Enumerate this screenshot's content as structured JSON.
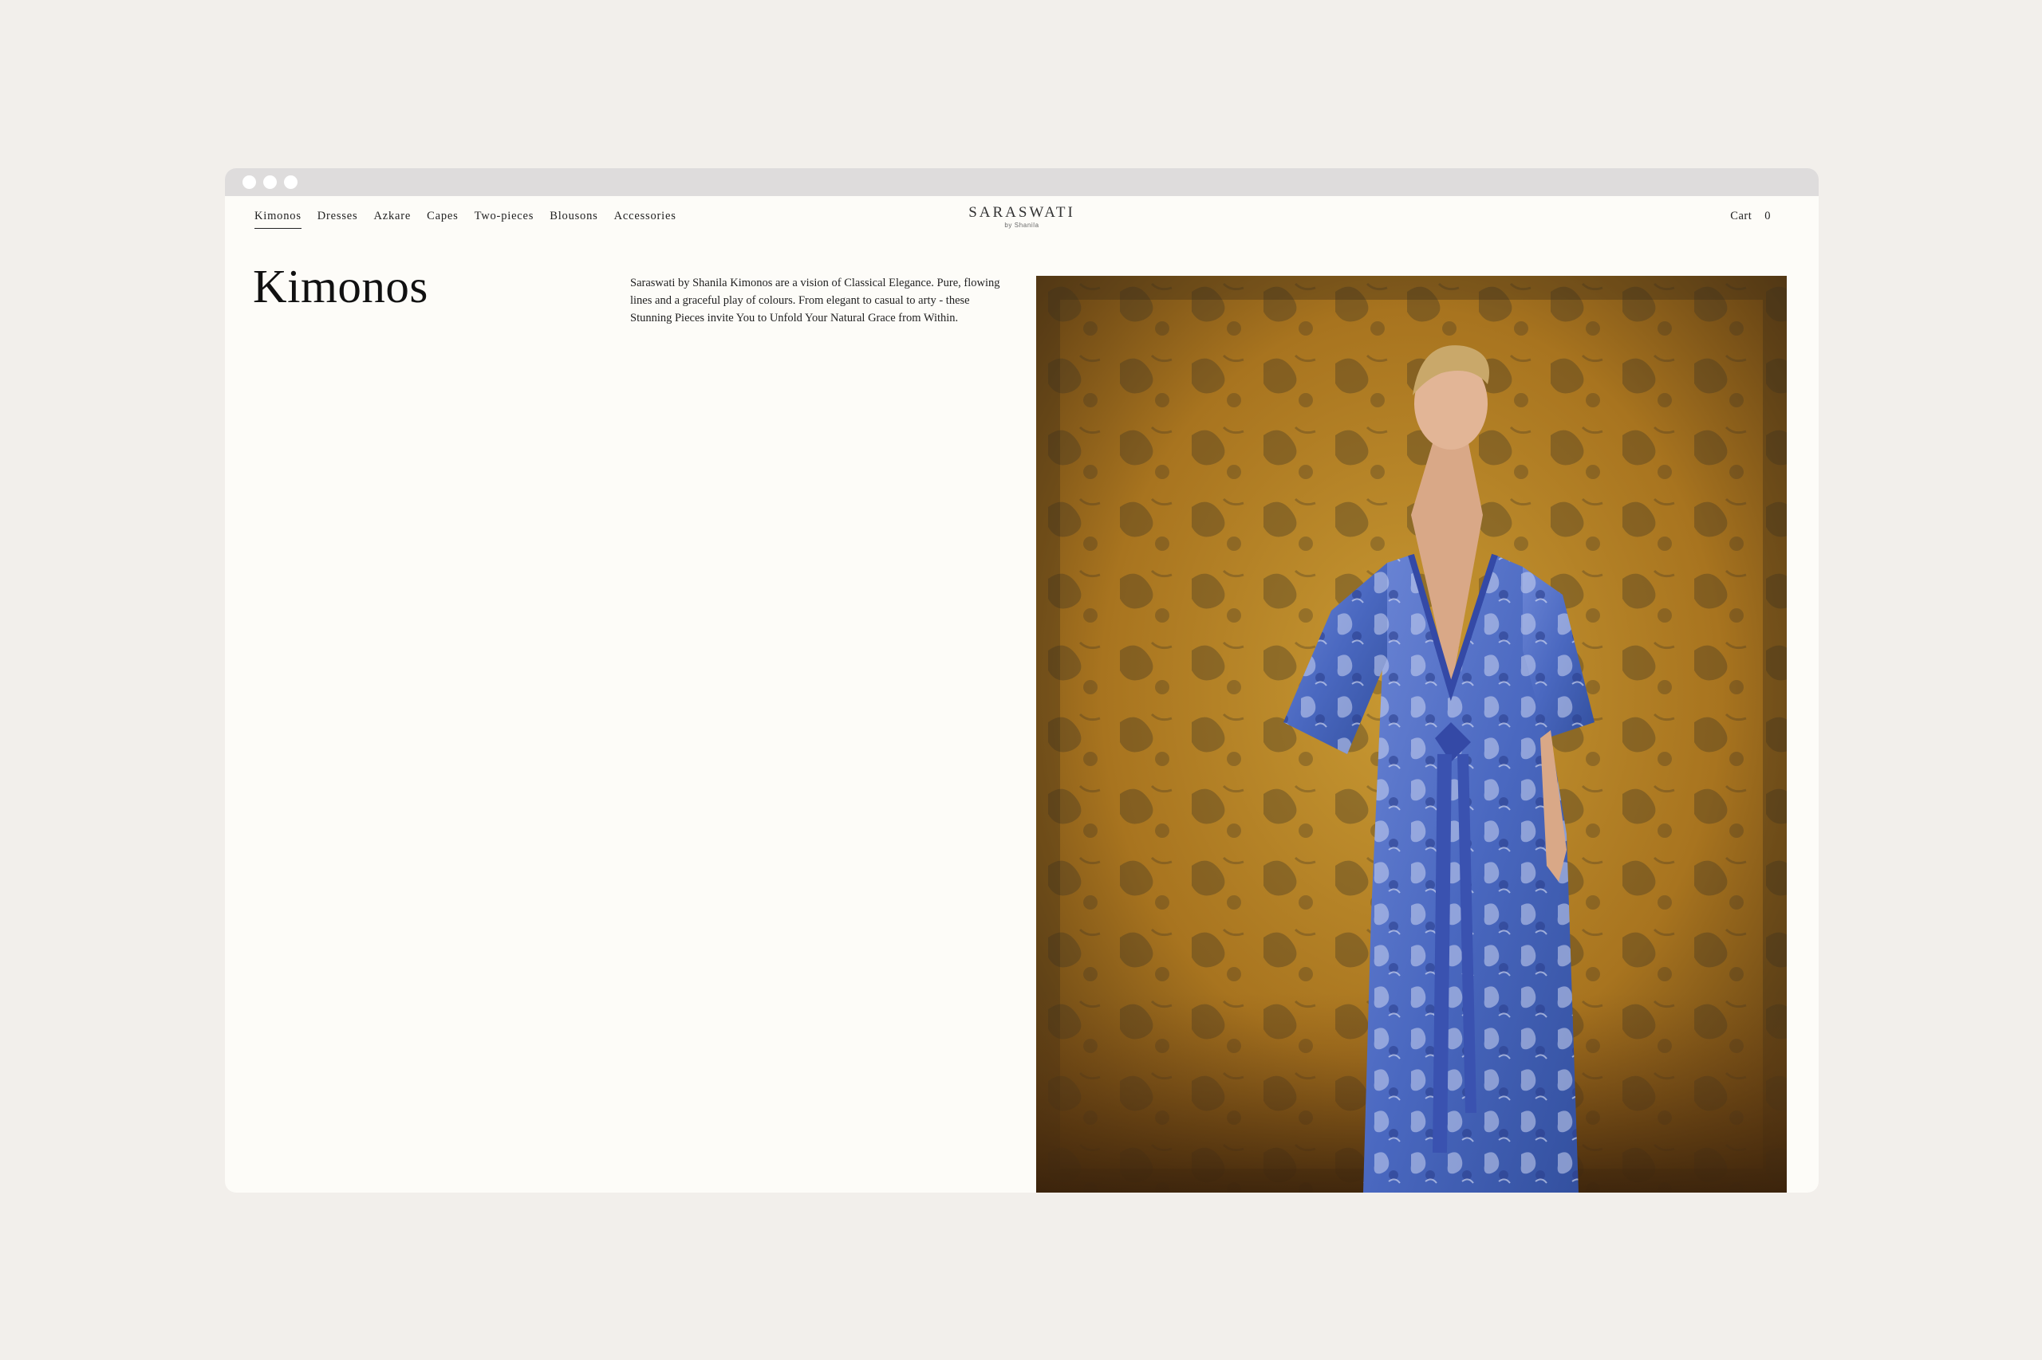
{
  "browser": {
    "window_controls": [
      "dot",
      "dot",
      "dot"
    ]
  },
  "header": {
    "nav": [
      {
        "label": "Kimonos",
        "active": true
      },
      {
        "label": "Dresses",
        "active": false
      },
      {
        "label": "Azkare",
        "active": false
      },
      {
        "label": "Capes",
        "active": false
      },
      {
        "label": "Two-pieces",
        "active": false
      },
      {
        "label": "Blousons",
        "active": false
      },
      {
        "label": "Accessories",
        "active": false
      }
    ],
    "logo": {
      "main": "SARASWATI",
      "sub": "by Shanila"
    },
    "cart": {
      "label": "Cart",
      "count": "0"
    }
  },
  "main": {
    "title": "Kimonos",
    "description": "Saraswati by Shanila Kimonos are a vision of Classical Elegance. Pure, flowing lines and a graceful play of colours. From elegant to casual to arty - these Stunning Pieces invite You to Unfold Your Natural Grace from Within.",
    "hero_image": {
      "subject": "model in blue paisley kimono against ochre patterned rug backdrop"
    }
  },
  "colors": {
    "page_bg": "#f2efeb",
    "window_bg": "#fdfcf8",
    "chrome_bar": "#dedcdc",
    "text": "#222222",
    "backdrop_ochre": "#b8862a",
    "kimono_blue": "#4f6fc4"
  }
}
